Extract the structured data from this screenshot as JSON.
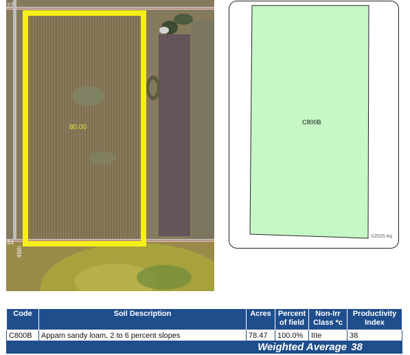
{
  "aerial": {
    "road_labels": [
      "27",
      "34",
      "46th"
    ],
    "field_acres": "80.00"
  },
  "soil_map": {
    "polygon_label": "C800B",
    "copyright": "©2025 Aq",
    "polygon_color": "#c6f7c6"
  },
  "table": {
    "headers": {
      "code": "Code",
      "description": "Soil Description",
      "acres": "Acres",
      "percent_line1": "Percent",
      "percent_line2": "of field",
      "class_line1": "Non-Irr",
      "class_line2": "Class *c",
      "pi_line1": "Productivity",
      "pi_line2": "Index"
    },
    "rows": [
      {
        "code": "C800B",
        "description": "Appam sandy loam, 2 to 6 percent slopes",
        "acres": "78.47",
        "percent": "100.0%",
        "class": "IIIe",
        "pi": "38"
      }
    ],
    "weighted_average_label": "Weighted Average",
    "weighted_average_value": "38"
  },
  "colors": {
    "header_blue": "#1f4e8c",
    "field_outline": "#f5ee1a"
  }
}
